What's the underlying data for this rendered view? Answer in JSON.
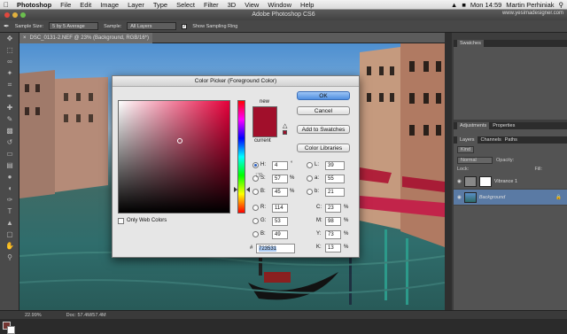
{
  "menubar": {
    "items": [
      "Photoshop",
      "File",
      "Edit",
      "Image",
      "Layer",
      "Type",
      "Select",
      "Filter",
      "3D",
      "View",
      "Window",
      "Help"
    ],
    "datetime": "Mon 14:59",
    "user": "Martin Perhiniak",
    "url": "www.yesimadesigner.com"
  },
  "app": {
    "title": "Adobe Photoshop CS6"
  },
  "options": {
    "sample_size_label": "Sample Size:",
    "sample_size": "5 by 5 Average",
    "sample_label": "Sample:",
    "sample": "All Layers",
    "ring_label": "Show Sampling Ring"
  },
  "document": {
    "tab": "DSC_0131-2.NEF @ 23% (Background, RGB/16*)"
  },
  "status": {
    "zoom": "22.99%",
    "doc": "Doc: 57.4M/57.4M"
  },
  "panels": {
    "swatches_tab": "Swatches",
    "adjustments_tab": "Adjustments",
    "properties_tab": "Properties",
    "layers_tab": "Layers",
    "channels_tab": "Channels",
    "paths_tab": "Paths",
    "kind": "Kind",
    "mode": "Normal",
    "opacity_label": "Opacity:",
    "lock_label": "Lock:",
    "fill_label": "Fill:",
    "layers": [
      {
        "name": "Vibrance 1"
      },
      {
        "name": "Background"
      }
    ]
  },
  "dialog": {
    "title": "Color Picker (Foreground Color)",
    "new_label": "new",
    "current_label": "current",
    "ok": "OK",
    "cancel": "Cancel",
    "add_swatches": "Add to Swatches",
    "libraries": "Color Libraries",
    "web_only": "Only Web Colors",
    "hsb": {
      "h": "4",
      "s": "57",
      "b": "45"
    },
    "rgb": {
      "r": "114",
      "g": "53",
      "b": "49"
    },
    "lab": {
      "l": "39",
      "a": "55",
      "b": "21"
    },
    "cmyk": {
      "c": "23",
      "m": "98",
      "y": "73",
      "k": "13"
    },
    "hex": "723531",
    "labels": {
      "h": "H:",
      "s": "S:",
      "b": "B:",
      "r": "R:",
      "g": "G:",
      "bb": "B:",
      "l": "L:",
      "a": "a:",
      "lb": "b:",
      "c": "C:",
      "m": "M:",
      "y": "Y:",
      "k": "K:",
      "hash": "#"
    },
    "units": {
      "deg": "°",
      "pct": "%"
    }
  },
  "colors": {
    "fg": "#723531",
    "picker_new": "#a10f2b",
    "ok_blue": "#4f8fe0"
  }
}
